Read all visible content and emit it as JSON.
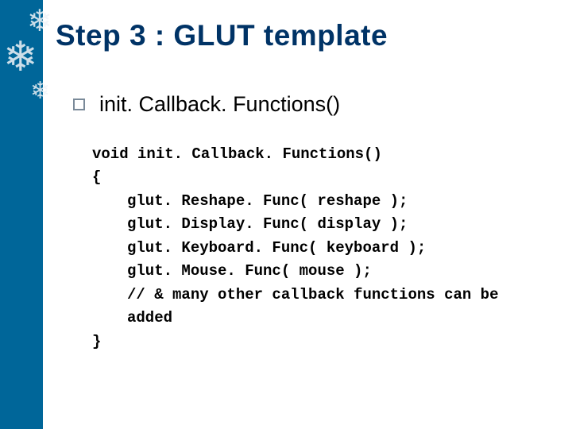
{
  "title": "Step 3 : GLUT template",
  "bullet": "init. Callback. Functions()",
  "code": {
    "l1": "void init. Callback. Functions()",
    "l2": "{",
    "l3": "glut. Reshape. Func( reshape );",
    "l4": "glut. Display. Func( display );",
    "l5": "glut. Keyboard. Func( keyboard );",
    "l6": "glut. Mouse. Func( mouse );",
    "l7": "// & many other callback functions can be added",
    "l8": "}"
  }
}
